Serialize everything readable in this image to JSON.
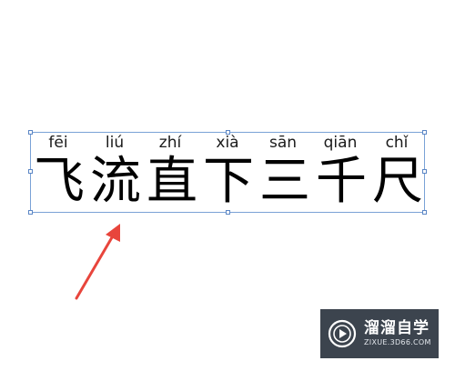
{
  "text_box": {
    "pinyin": [
      "fēi",
      "liú",
      "zhí",
      "xià",
      "sān",
      "qiān",
      "chǐ"
    ],
    "hanzi": [
      "飞",
      "流",
      "直",
      "下",
      "三",
      "千",
      "尺"
    ]
  },
  "annotation": {
    "arrow_color": "#e8453c"
  },
  "watermark": {
    "title": "溜溜自学",
    "url": "ZIXUE.3D66.COM",
    "logo_icon": "play-icon"
  },
  "colors": {
    "selection_border": "#7aa2d6",
    "watermark_bg": "#2c3540"
  }
}
